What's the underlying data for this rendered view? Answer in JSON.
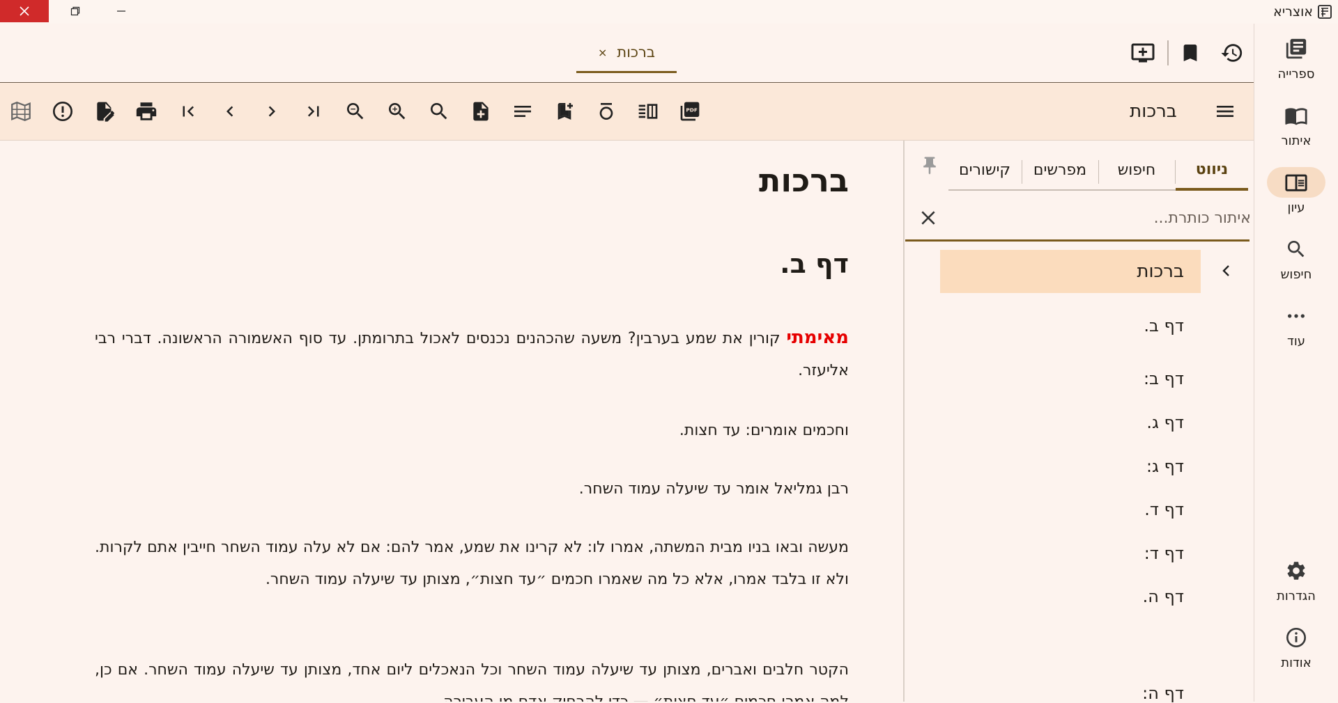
{
  "app": {
    "title": "אוצריא",
    "icon": "app-book-icon"
  },
  "window_controls": {
    "close": "close-icon",
    "restore": "restore-icon",
    "minimize": "minimize-icon"
  },
  "nav_rail": {
    "items": [
      {
        "label": "ספרייה",
        "icon": "library-icon"
      },
      {
        "label": "איתור",
        "icon": "find-book-icon"
      },
      {
        "label": "עיון",
        "icon": "reading-icon"
      },
      {
        "label": "חיפוש",
        "icon": "search-icon"
      },
      {
        "label": "עוד",
        "icon": "more-icon"
      },
      {
        "label": "הגדרות",
        "icon": "settings-icon"
      },
      {
        "label": "אודות",
        "icon": "info-icon"
      }
    ],
    "active": "עיון"
  },
  "topbar": {
    "icons": [
      "history-icon",
      "bookmark-icon",
      "add-workspace-icon"
    ],
    "tab": {
      "label": "ברכות",
      "close": "×"
    }
  },
  "toolbar": {
    "menu_icon": "menu-icon",
    "book_title": "ברכות",
    "icons": [
      "pdf-icon",
      "split-view-icon",
      "nikud-icon",
      "add-bookmark-icon",
      "text-align-icon",
      "add-note-icon",
      "find-in-page-icon",
      "zoom-in-icon",
      "zoom-out-icon",
      "last-page-icon",
      "next-icon",
      "previous-icon",
      "first-page-icon",
      "edit-icon",
      "print-icon",
      "report-error-icon",
      "shas-map-icon"
    ]
  },
  "document": {
    "title": "ברכות",
    "daf": "דף ב.",
    "paragraphs": [
      {
        "lead": "מאימתי",
        "text": " קורין את שמע בערבין? משעה שהכהנים נכנסים לאכול בתרומתן. עד סוף האשמורה הראשונה. דברי רבי אליעזר."
      },
      {
        "lead": "",
        "text": "וחכמים אומרים: עד חצות."
      },
      {
        "lead": "",
        "text": "רבן גמליאל אומר עד שיעלה עמוד השחר."
      },
      {
        "lead": "",
        "text": "מעשה ובאו בניו מבית המשתה, אמרו לו: לא קרינו את שמע, אמר להם: אם לא עלה עמוד השחר חייבין אתם לקרות. ולא זו בלבד אמרו, אלא כל מה שאמרו חכמים ״עד חצות״, מצותן עד שיעלה עמוד השחר."
      },
      {
        "lead": "",
        "text": "הקטר חלבים ואברים, מצותן עד שיעלה עמוד השחר וכל הנאכלים ליום אחד, מצותן עד שיעלה עמוד השחר. אם כן, למה אמרו חכמים ״עד חצות״ — כדי להרחיק אדם מן העבירה."
      }
    ]
  },
  "side_panel": {
    "pin_icon": "pin-icon",
    "tabs": [
      "ניווט",
      "חיפוש",
      "מפרשים",
      "קישורים"
    ],
    "active_tab": "ניווט",
    "search_placeholder": "איתור כותרת...",
    "clear_icon": "clear-icon",
    "toc_root": "ברכות",
    "toc_items": [
      "דף ב.",
      "דף ב:",
      "דף ג.",
      "דף ג:",
      "דף ד.",
      "דף ד:",
      "דף ה.",
      "דף ה:"
    ]
  }
}
